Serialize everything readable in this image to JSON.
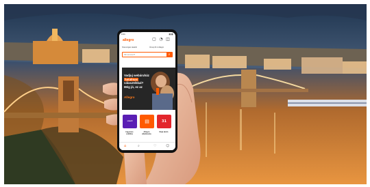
{
  "image": {
    "description_free": true
  },
  "app": {
    "logo": "allegro",
    "status_time": "9:41",
    "status_icons": "▮▮▮",
    "header_icons": [
      {
        "name": "bookmark-icon",
        "glyph": "▢"
      },
      {
        "name": "bell-icon",
        "glyph": "◔"
      },
      {
        "name": "cart-icon",
        "glyph": "◫"
      }
    ],
    "links": [
      "Szervezgés vásárló",
      "Ünnep fit in Allegro"
    ],
    "search_placeholder": "Mit keresel?",
    "search_icon": "⌕",
    "banner": {
      "line1": "Vadjuj webáruház",
      "line2": "hatalmas",
      "line3": "választékkal?",
      "line4": "Még jó, ez az",
      "brand": "Allegro"
    },
    "categories": [
      {
        "icon": "smart!",
        "label": "Ingyenes szállítás",
        "color": "#5a1eb4"
      },
      {
        "icon": "▤",
        "label": "Allegro alkalmazás",
        "color": "#ff5a00"
      },
      {
        "icon": "31",
        "label": "Napi akció",
        "color": "#e3262c"
      }
    ],
    "tabbar_icons": [
      {
        "name": "home-tab-icon",
        "glyph": "⌂"
      },
      {
        "name": "search-tab-icon",
        "glyph": "⌕"
      },
      {
        "name": "favorites-tab-icon",
        "glyph": "♡"
      },
      {
        "name": "account-tab-icon",
        "glyph": "☺"
      }
    ],
    "accent": "#ff5a00"
  }
}
